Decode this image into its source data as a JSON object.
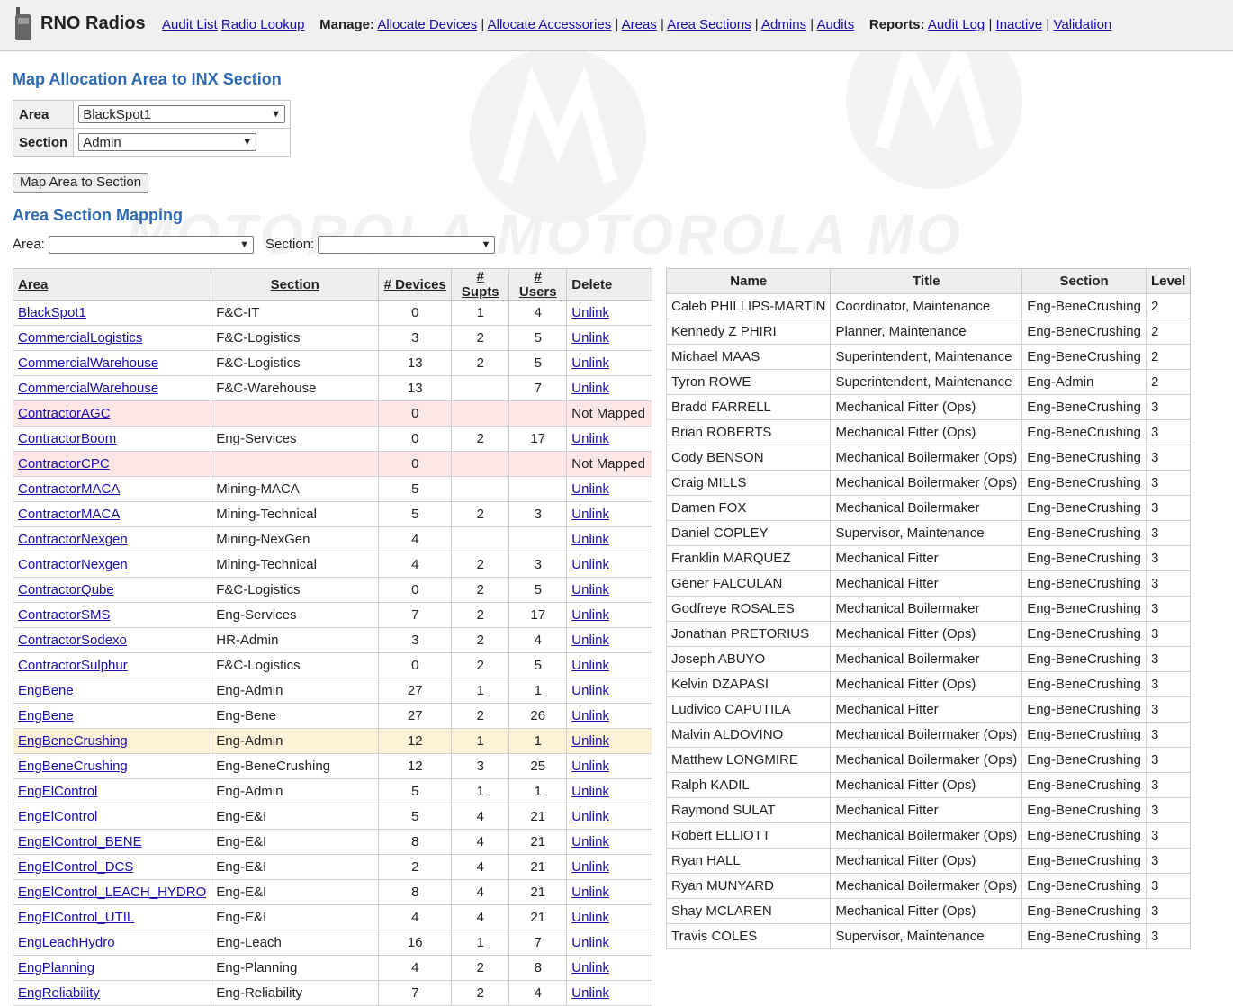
{
  "header": {
    "brand": "RNO Radios",
    "links1": [
      "Audit List",
      "Radio Lookup"
    ],
    "manage_label": "Manage:",
    "manage_links": [
      "Allocate Devices",
      "Allocate Accessories",
      "Areas",
      "Area Sections",
      "Admins",
      "Audits"
    ],
    "reports_label": "Reports:",
    "report_links": [
      "Audit Log",
      "Inactive",
      "Validation"
    ]
  },
  "map_form": {
    "title": "Map Allocation Area to INX Section",
    "area_label": "Area",
    "area_value": "BlackSpot1",
    "section_label": "Section",
    "section_value": "Admin",
    "button": "Map Area to Section"
  },
  "mapping": {
    "title": "Area Section Mapping",
    "filter_area_label": "Area:",
    "filter_area_value": "",
    "filter_section_label": "Section:",
    "filter_section_value": "",
    "columns": [
      "Area",
      "Section",
      "# Devices",
      "# Supts",
      "# Users",
      "Delete"
    ],
    "rows": [
      {
        "area": "BlackSpot1",
        "section": "F&C-IT",
        "devices": "0",
        "supts": "1",
        "users": "4",
        "action": "Unlink",
        "state": ""
      },
      {
        "area": "CommercialLogistics",
        "section": "F&C-Logistics",
        "devices": "3",
        "supts": "2",
        "users": "5",
        "action": "Unlink",
        "state": ""
      },
      {
        "area": "CommercialWarehouse",
        "section": "F&C-Logistics",
        "devices": "13",
        "supts": "2",
        "users": "5",
        "action": "Unlink",
        "state": ""
      },
      {
        "area": "CommercialWarehouse",
        "section": "F&C-Warehouse",
        "devices": "13",
        "supts": "",
        "users": "7",
        "action": "Unlink",
        "state": ""
      },
      {
        "area": "ContractorAGC",
        "section": "",
        "devices": "0",
        "supts": "",
        "users": "",
        "action": "Not Mapped",
        "state": "unmapped"
      },
      {
        "area": "ContractorBoom",
        "section": "Eng-Services",
        "devices": "0",
        "supts": "2",
        "users": "17",
        "action": "Unlink",
        "state": ""
      },
      {
        "area": "ContractorCPC",
        "section": "",
        "devices": "0",
        "supts": "",
        "users": "",
        "action": "Not Mapped",
        "state": "unmapped"
      },
      {
        "area": "ContractorMACA",
        "section": "Mining-MACA",
        "devices": "5",
        "supts": "",
        "users": "",
        "action": "Unlink",
        "state": ""
      },
      {
        "area": "ContractorMACA",
        "section": "Mining-Technical",
        "devices": "5",
        "supts": "2",
        "users": "3",
        "action": "Unlink",
        "state": ""
      },
      {
        "area": "ContractorNexgen",
        "section": "Mining-NexGen",
        "devices": "4",
        "supts": "",
        "users": "",
        "action": "Unlink",
        "state": ""
      },
      {
        "area": "ContractorNexgen",
        "section": "Mining-Technical",
        "devices": "4",
        "supts": "2",
        "users": "3",
        "action": "Unlink",
        "state": ""
      },
      {
        "area": "ContractorQube",
        "section": "F&C-Logistics",
        "devices": "0",
        "supts": "2",
        "users": "5",
        "action": "Unlink",
        "state": ""
      },
      {
        "area": "ContractorSMS",
        "section": "Eng-Services",
        "devices": "7",
        "supts": "2",
        "users": "17",
        "action": "Unlink",
        "state": ""
      },
      {
        "area": "ContractorSodexo",
        "section": "HR-Admin",
        "devices": "3",
        "supts": "2",
        "users": "4",
        "action": "Unlink",
        "state": ""
      },
      {
        "area": "ContractorSulphur",
        "section": "F&C-Logistics",
        "devices": "0",
        "supts": "2",
        "users": "5",
        "action": "Unlink",
        "state": ""
      },
      {
        "area": "EngBene",
        "section": "Eng-Admin",
        "devices": "27",
        "supts": "1",
        "users": "1",
        "action": "Unlink",
        "state": ""
      },
      {
        "area": "EngBene",
        "section": "Eng-Bene",
        "devices": "27",
        "supts": "2",
        "users": "26",
        "action": "Unlink",
        "state": ""
      },
      {
        "area": "EngBeneCrushing",
        "section": "Eng-Admin",
        "devices": "12",
        "supts": "1",
        "users": "1",
        "action": "Unlink",
        "state": "hl"
      },
      {
        "area": "EngBeneCrushing",
        "section": "Eng-BeneCrushing",
        "devices": "12",
        "supts": "3",
        "users": "25",
        "action": "Unlink",
        "state": ""
      },
      {
        "area": "EngElControl",
        "section": "Eng-Admin",
        "devices": "5",
        "supts": "1",
        "users": "1",
        "action": "Unlink",
        "state": ""
      },
      {
        "area": "EngElControl",
        "section": "Eng-E&I",
        "devices": "5",
        "supts": "4",
        "users": "21",
        "action": "Unlink",
        "state": ""
      },
      {
        "area": "EngElControl_BENE",
        "section": "Eng-E&I",
        "devices": "8",
        "supts": "4",
        "users": "21",
        "action": "Unlink",
        "state": ""
      },
      {
        "area": "EngElControl_DCS",
        "section": "Eng-E&I",
        "devices": "2",
        "supts": "4",
        "users": "21",
        "action": "Unlink",
        "state": ""
      },
      {
        "area": "EngElControl_LEACH_HYDRO",
        "section": "Eng-E&I",
        "devices": "8",
        "supts": "4",
        "users": "21",
        "action": "Unlink",
        "state": ""
      },
      {
        "area": "EngElControl_UTIL",
        "section": "Eng-E&I",
        "devices": "4",
        "supts": "4",
        "users": "21",
        "action": "Unlink",
        "state": ""
      },
      {
        "area": "EngLeachHydro",
        "section": "Eng-Leach",
        "devices": "16",
        "supts": "1",
        "users": "7",
        "action": "Unlink",
        "state": ""
      },
      {
        "area": "EngPlanning",
        "section": "Eng-Planning",
        "devices": "4",
        "supts": "2",
        "users": "8",
        "action": "Unlink",
        "state": ""
      },
      {
        "area": "EngReliability",
        "section": "Eng-Reliability",
        "devices": "7",
        "supts": "2",
        "users": "4",
        "action": "Unlink",
        "state": ""
      }
    ]
  },
  "users": {
    "columns": [
      "Name",
      "Title",
      "Section",
      "Level"
    ],
    "rows": [
      [
        "Caleb PHILLIPS-MARTIN",
        "Coordinator, Maintenance",
        "Eng-BeneCrushing",
        "2"
      ],
      [
        "Kennedy Z PHIRI",
        "Planner, Maintenance",
        "Eng-BeneCrushing",
        "2"
      ],
      [
        "Michael MAAS",
        "Superintendent, Maintenance",
        "Eng-BeneCrushing",
        "2"
      ],
      [
        "Tyron ROWE",
        "Superintendent, Maintenance",
        "Eng-Admin",
        "2"
      ],
      [
        "Bradd FARRELL",
        "Mechanical Fitter (Ops)",
        "Eng-BeneCrushing",
        "3"
      ],
      [
        "Brian ROBERTS",
        "Mechanical Fitter (Ops)",
        "Eng-BeneCrushing",
        "3"
      ],
      [
        "Cody BENSON",
        "Mechanical Boilermaker (Ops)",
        "Eng-BeneCrushing",
        "3"
      ],
      [
        "Craig MILLS",
        "Mechanical Boilermaker (Ops)",
        "Eng-BeneCrushing",
        "3"
      ],
      [
        "Damen FOX",
        "Mechanical Boilermaker",
        "Eng-BeneCrushing",
        "3"
      ],
      [
        "Daniel COPLEY",
        "Supervisor, Maintenance",
        "Eng-BeneCrushing",
        "3"
      ],
      [
        "Franklin MARQUEZ",
        "Mechanical Fitter",
        "Eng-BeneCrushing",
        "3"
      ],
      [
        "Gener FALCULAN",
        "Mechanical Fitter",
        "Eng-BeneCrushing",
        "3"
      ],
      [
        "Godfreye ROSALES",
        "Mechanical Boilermaker",
        "Eng-BeneCrushing",
        "3"
      ],
      [
        "Jonathan PRETORIUS",
        "Mechanical Fitter (Ops)",
        "Eng-BeneCrushing",
        "3"
      ],
      [
        "Joseph ABUYO",
        "Mechanical Boilermaker",
        "Eng-BeneCrushing",
        "3"
      ],
      [
        "Kelvin DZAPASI",
        "Mechanical Fitter (Ops)",
        "Eng-BeneCrushing",
        "3"
      ],
      [
        "Ludivico CAPUTILA",
        "Mechanical Fitter",
        "Eng-BeneCrushing",
        "3"
      ],
      [
        "Malvin ALDOVINO",
        "Mechanical Boilermaker (Ops)",
        "Eng-BeneCrushing",
        "3"
      ],
      [
        "Matthew LONGMIRE",
        "Mechanical Boilermaker (Ops)",
        "Eng-BeneCrushing",
        "3"
      ],
      [
        "Ralph KADIL",
        "Mechanical Fitter (Ops)",
        "Eng-BeneCrushing",
        "3"
      ],
      [
        "Raymond SULAT",
        "Mechanical Fitter",
        "Eng-BeneCrushing",
        "3"
      ],
      [
        "Robert ELLIOTT",
        "Mechanical Boilermaker (Ops)",
        "Eng-BeneCrushing",
        "3"
      ],
      [
        "Ryan HALL",
        "Mechanical Fitter (Ops)",
        "Eng-BeneCrushing",
        "3"
      ],
      [
        "Ryan MUNYARD",
        "Mechanical Boilermaker (Ops)",
        "Eng-BeneCrushing",
        "3"
      ],
      [
        "Shay MCLAREN",
        "Mechanical Fitter (Ops)",
        "Eng-BeneCrushing",
        "3"
      ],
      [
        "Travis COLES",
        "Supervisor, Maintenance",
        "Eng-BeneCrushing",
        "3"
      ]
    ]
  },
  "watermark": {
    "text": "MOTOROLA MOTOROLA MO"
  },
  "colors": {
    "heading": "#2e6ab3",
    "link": "#1a0dab",
    "unmapped_row": "#fde6e6",
    "highlight_row": "#fdf2d8"
  }
}
